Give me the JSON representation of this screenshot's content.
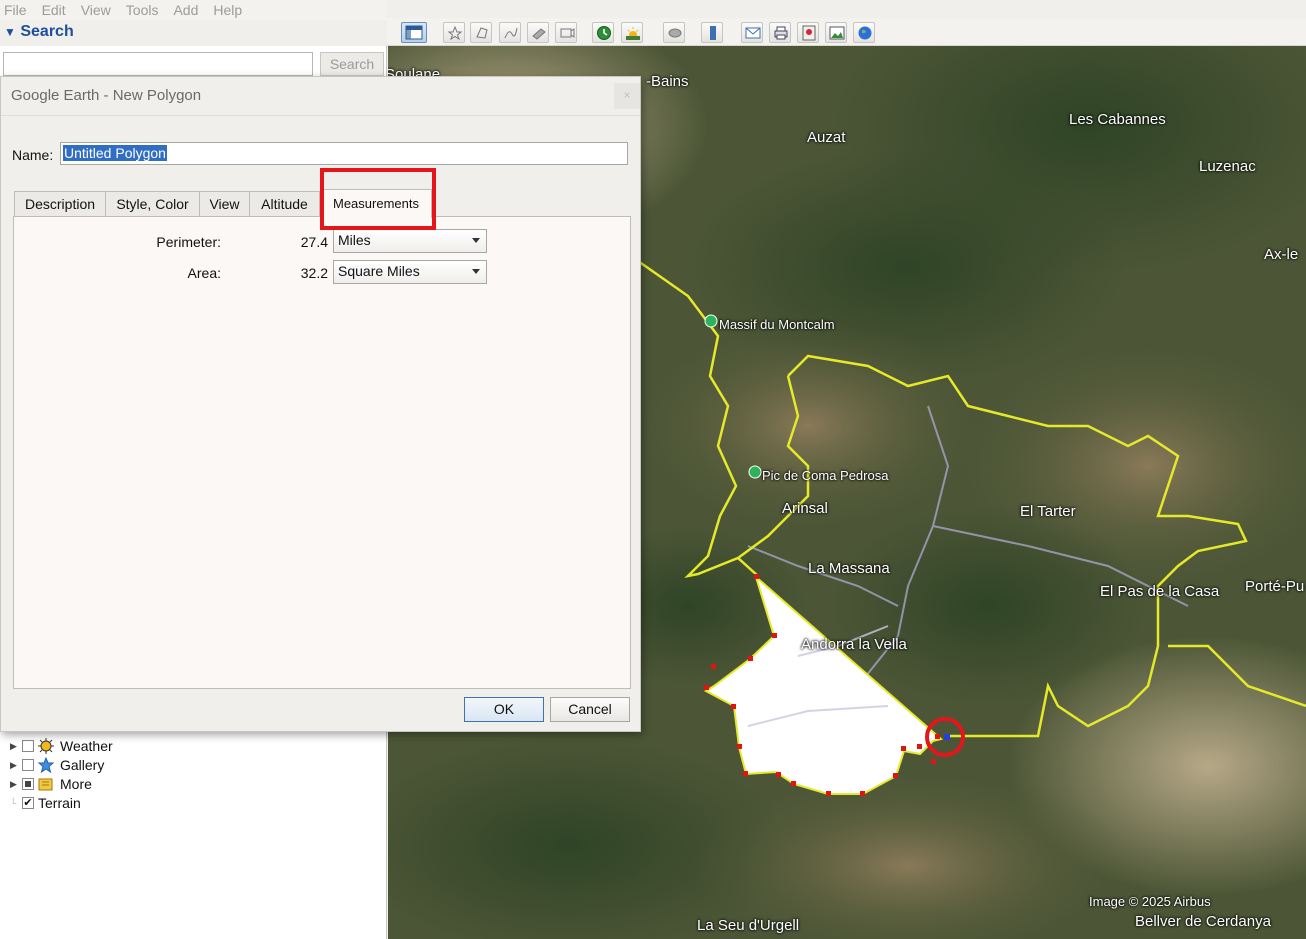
{
  "menu": [
    "File",
    "Edit",
    "View",
    "Tools",
    "Add",
    "Help"
  ],
  "search": {
    "header": "Search",
    "button": "Search",
    "value": ""
  },
  "layers": [
    {
      "label": "Weather",
      "checked": false,
      "icon": "weather-icon"
    },
    {
      "label": "Gallery",
      "checked": false,
      "icon": "gallery-star-icon"
    },
    {
      "label": "More",
      "checked": "partial",
      "icon": "more-folder-icon"
    },
    {
      "label": "Terrain",
      "checked": true,
      "icon": ""
    }
  ],
  "map": {
    "labels": {
      "bains": "-Bains",
      "soulane": "Soulane",
      "auzat": "Auzat",
      "les_cabannes": "Les Cabannes",
      "luzenac": "Luzenac",
      "ax": "Ax-le",
      "montcalm": "Massif du Montcalm",
      "coma_pedrosa": "Pic de Coma Pedrosa",
      "arinsal": "Arinsal",
      "el_tarter": "El Tarter",
      "la_massana": "La Massana",
      "el_pas": "El Pas de la Casa",
      "porte": "Porté-Pu",
      "andorra": "Andorra la Vella",
      "seu": "La Seu d'Urgell",
      "bellver": "Bellver de Cerdanya",
      "copyright": "Image © 2025 Airbus"
    }
  },
  "dialog": {
    "title": "Google Earth - New Polygon",
    "close": "×",
    "name_label": "Name:",
    "name_value": "Untitled Polygon",
    "tabs": [
      "Description",
      "Style, Color",
      "View",
      "Altitude",
      "Measurements"
    ],
    "active_tab": "Measurements",
    "measurements": {
      "perimeter_label": "Perimeter:",
      "perimeter_value": "27.4",
      "perimeter_unit": "Miles",
      "area_label": "Area:",
      "area_value": "32.2",
      "area_unit": "Square Miles"
    },
    "ok": "OK",
    "cancel": "Cancel"
  },
  "colors": {
    "highlight": "#e4161b",
    "border_line": "#ecec22",
    "polygon_fill": "#ffffff",
    "vertex": "#e01414",
    "selection": "#2f6ec2"
  }
}
